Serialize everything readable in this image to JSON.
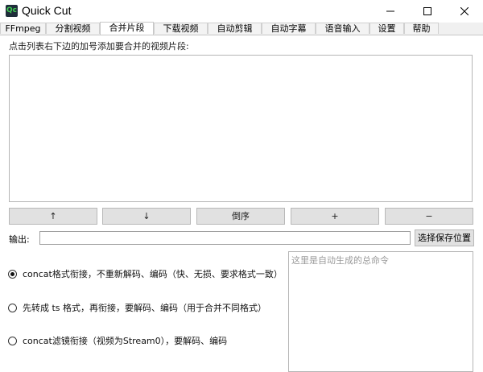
{
  "window": {
    "icon_text": "Qc",
    "title": "Quick Cut",
    "minimize_glyph": "minimize-icon",
    "maximize_glyph": "maximize-icon",
    "close_glyph": "close-icon"
  },
  "tabs": [
    {
      "label": "FFmpeg"
    },
    {
      "label": "分割视频"
    },
    {
      "label": "合并片段",
      "active": true
    },
    {
      "label": "下载视频"
    },
    {
      "label": "自动剪辑"
    },
    {
      "label": "自动字幕"
    },
    {
      "label": "语音输入"
    },
    {
      "label": "设置"
    },
    {
      "label": "帮助"
    }
  ],
  "merge": {
    "instruction": "点击列表右下边的加号添加要合并的视频片段:",
    "buttons": {
      "up": "↑",
      "down": "↓",
      "reverse": "倒序",
      "add": "+",
      "remove": "−"
    },
    "output_label": "输出:",
    "output_value": "",
    "save_location_button": "选择保存位置",
    "command_placeholder": "这里是自动生成的总命令",
    "options": [
      {
        "label": "concat格式衔接，不重新解码、编码（快、无损、要求格式一致）",
        "checked": true
      },
      {
        "label": "先转成 ts 格式，再衔接，要解码、编码（用于合并不同格式）",
        "checked": false
      },
      {
        "label": "concat滤镜衔接（视频为Stream0），要解码、编码",
        "checked": false
      }
    ]
  }
}
